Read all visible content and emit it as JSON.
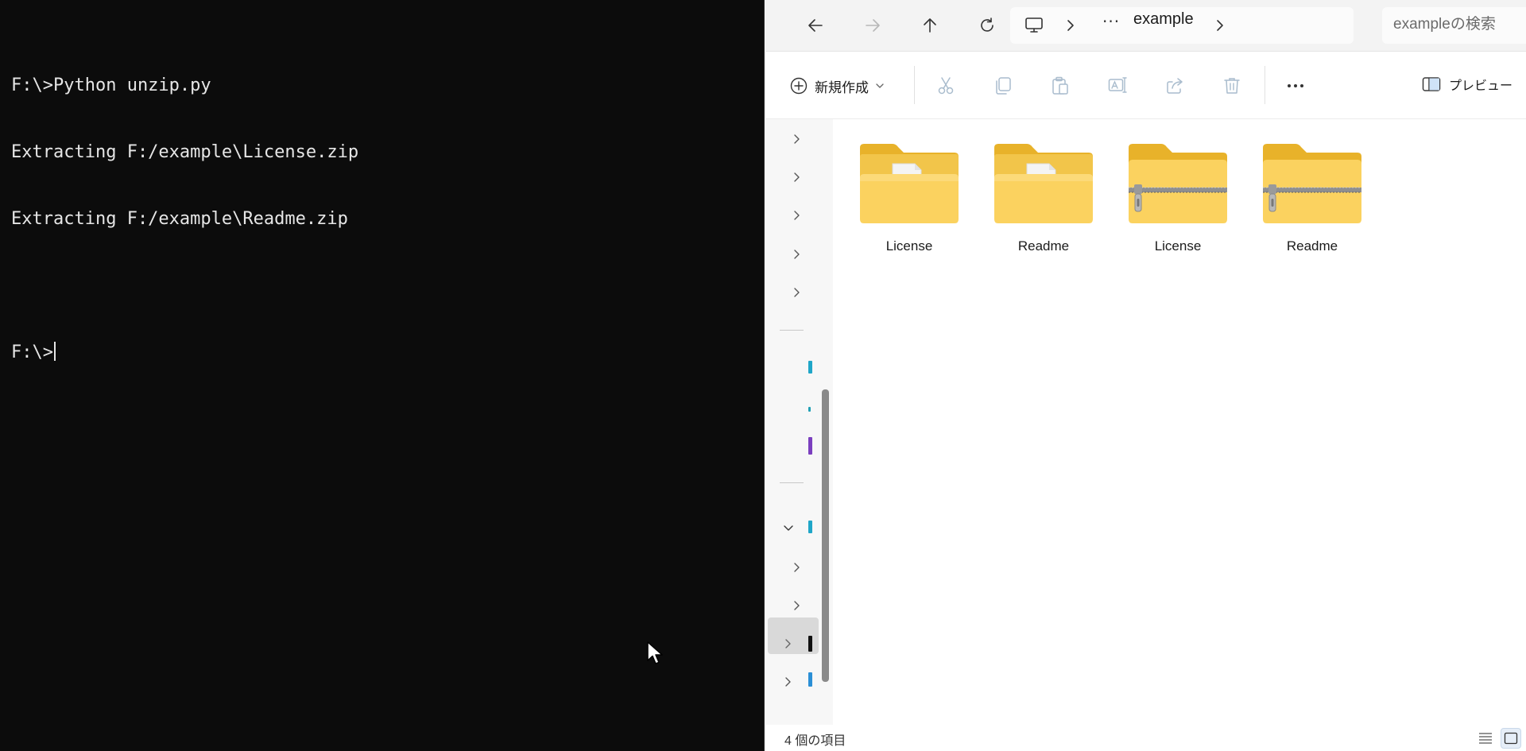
{
  "terminal": {
    "lines": [
      "F:\\>Python unzip.py",
      "Extracting F:/example\\License.zip",
      "Extracting F:/example\\Readme.zip",
      "",
      "F:\\>"
    ]
  },
  "explorer": {
    "address": {
      "more": "···",
      "folder": "example"
    },
    "search": {
      "placeholder": "exampleの検索"
    },
    "commandbar": {
      "new_label": "新規作成",
      "preview_label": "プレビュー"
    },
    "items": [
      {
        "name": "License",
        "type": "folder"
      },
      {
        "name": "Readme",
        "type": "folder"
      },
      {
        "name": "License",
        "type": "zip"
      },
      {
        "name": "Readme",
        "type": "zip"
      }
    ],
    "status": {
      "item_count": "4 個の項目"
    }
  },
  "colors": {
    "terminal_bg": "#0c0c0c",
    "folder_yellow": "#f7c948",
    "accent": "#0067c0"
  }
}
